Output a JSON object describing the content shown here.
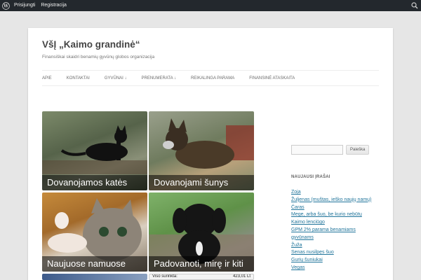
{
  "adminbar": {
    "login_label": "Prisijungti",
    "register_label": "Registracija"
  },
  "site": {
    "title": "VšĮ „Kaimo grandinė“",
    "description": "Finansiškai skaidri benamių gyvūnų globos organizacija"
  },
  "nav": {
    "items": [
      "Apie",
      "Kontaktai",
      "Gyvūnai ↓",
      "Prenumerata ↓",
      "Reikalinga parama",
      "Finansinė ataskaita"
    ]
  },
  "grid": {
    "tiles": [
      "Dovanojamos katės",
      "Dovanojami šunys",
      "Naujuose namuose",
      "Padovanoti, mirę ir kiti"
    ],
    "footer_label": "Viso surinkta:",
    "footer_value": "423,01 Lt"
  },
  "sidebar": {
    "search_button": "Paieška",
    "recent_title": "Naujausi įrašai",
    "recent_posts": [
      "Zoja",
      "Žuljenas (muštas, ieško naujų namų)",
      "Čaras",
      "Mege, arba šuo, be kurio nebūtų",
      "Kaimo lenciūgo",
      "GPM 2% parama benamiams",
      "gyvūnams",
      "Žuža",
      "Senas nusilpęs šuo",
      "Gurių šuniukai",
      "Vegas"
    ]
  }
}
